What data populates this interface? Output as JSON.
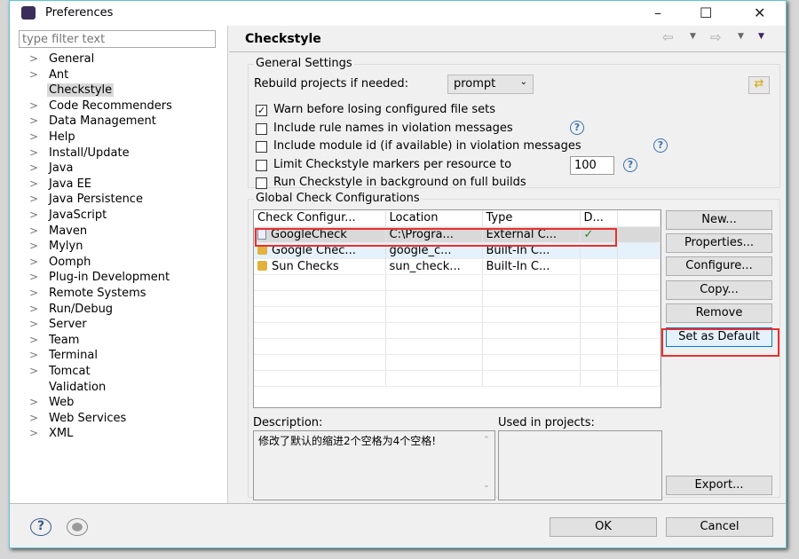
{
  "window": {
    "title": "Preferences",
    "minimize": "–",
    "maximize": "☐",
    "close": "✕"
  },
  "filter": {
    "placeholder": "type filter text"
  },
  "tree": [
    {
      "label": "General",
      "expandable": true
    },
    {
      "label": "Ant",
      "expandable": true
    },
    {
      "label": "Checkstyle",
      "expandable": false,
      "selected": true
    },
    {
      "label": "Code Recommenders",
      "expandable": true
    },
    {
      "label": "Data Management",
      "expandable": true
    },
    {
      "label": "Help",
      "expandable": true
    },
    {
      "label": "Install/Update",
      "expandable": true
    },
    {
      "label": "Java",
      "expandable": true
    },
    {
      "label": "Java EE",
      "expandable": true
    },
    {
      "label": "Java Persistence",
      "expandable": true
    },
    {
      "label": "JavaScript",
      "expandable": true
    },
    {
      "label": "Maven",
      "expandable": true
    },
    {
      "label": "Mylyn",
      "expandable": true
    },
    {
      "label": "Oomph",
      "expandable": true
    },
    {
      "label": "Plug-in Development",
      "expandable": true
    },
    {
      "label": "Remote Systems",
      "expandable": true
    },
    {
      "label": "Run/Debug",
      "expandable": true
    },
    {
      "label": "Server",
      "expandable": true
    },
    {
      "label": "Team",
      "expandable": true
    },
    {
      "label": "Terminal",
      "expandable": true
    },
    {
      "label": "Tomcat",
      "expandable": true
    },
    {
      "label": "Validation",
      "expandable": false
    },
    {
      "label": "Web",
      "expandable": true
    },
    {
      "label": "Web Services",
      "expandable": true
    },
    {
      "label": "XML",
      "expandable": true
    }
  ],
  "page": {
    "title": "Checkstyle"
  },
  "general": {
    "title": "General Settings",
    "rebuild_label": "Rebuild projects if needed:",
    "rebuild_value": "prompt",
    "options": [
      {
        "label": "Warn before losing configured file sets",
        "checked": true
      },
      {
        "label": "Include rule names in violation messages",
        "checked": false
      },
      {
        "label": "Include module id (if available) in violation messages",
        "checked": false
      },
      {
        "label": "Limit Checkstyle markers per resource to",
        "checked": false
      },
      {
        "label": "Run Checkstyle in background on full builds",
        "checked": false
      }
    ],
    "limit_value": "100"
  },
  "global": {
    "title": "Global Check Configurations",
    "columns": [
      "Check Configur...",
      "Location",
      "Type",
      "D..."
    ],
    "rows": [
      {
        "name": "GoogleCheck",
        "location": "C:\\Progra...",
        "type": "External C...",
        "default": "✓",
        "icon": "document-icon"
      },
      {
        "name": "Google Chec...",
        "location": "google_c...",
        "type": "Built-In C...",
        "default": "",
        "icon": "lock-icon"
      },
      {
        "name": "Sun Checks",
        "location": "sun_check...",
        "type": "Built-In C...",
        "default": "",
        "icon": "lock-icon"
      }
    ],
    "buttons": {
      "new": "New...",
      "properties": "Properties...",
      "configure": "Configure...",
      "copy": "Copy...",
      "remove": "Remove",
      "set_default": "Set as Default",
      "export": "Export..."
    },
    "description_label": "Description:",
    "description": "修改了默认的缩进2个空格为4个空格!",
    "used_label": "Used in projects:"
  },
  "footer": {
    "ok": "OK",
    "cancel": "Cancel"
  },
  "colors": {
    "highlight": "#e8302f",
    "selection": "#d9d9d9",
    "frame": "#5bc4d6"
  }
}
